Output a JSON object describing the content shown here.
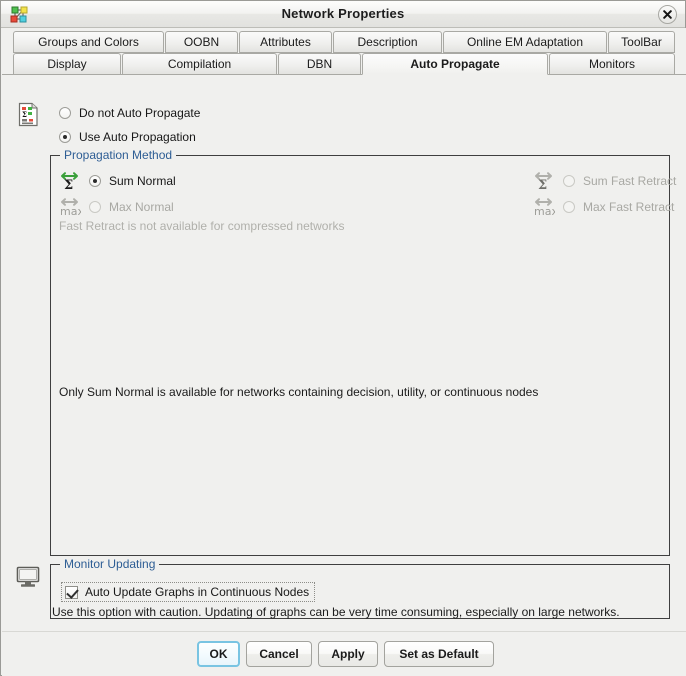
{
  "window": {
    "title": "Network Properties",
    "app_icon": "network-graph-icon",
    "close_label": "✖"
  },
  "tabs": {
    "row1": [
      {
        "label": "Groups and Colors",
        "selected": false
      },
      {
        "label": "OOBN",
        "selected": false
      },
      {
        "label": "Attributes",
        "selected": false
      },
      {
        "label": "Description",
        "selected": false
      },
      {
        "label": "Online EM Adaptation",
        "selected": false
      },
      {
        "label": "ToolBar",
        "selected": false
      }
    ],
    "row2": [
      {
        "label": "Display",
        "selected": false
      },
      {
        "label": "Compilation",
        "selected": false
      },
      {
        "label": "DBN",
        "selected": false
      },
      {
        "label": "Auto Propagate",
        "selected": true
      },
      {
        "label": "Monitors",
        "selected": false
      }
    ]
  },
  "auto_propagate": {
    "mode_options": [
      {
        "label": "Do not Auto Propagate",
        "checked": false,
        "disabled": false
      },
      {
        "label": "Use Auto Propagation",
        "checked": true,
        "disabled": false
      }
    ],
    "propagation_method": {
      "legend": "Propagation Method",
      "left_column": [
        {
          "label": "Sum Normal",
          "checked": true,
          "disabled": false,
          "icon": "sum-sigma-icon"
        },
        {
          "label": "Max Normal",
          "checked": false,
          "disabled": true,
          "icon": "max-icon"
        }
      ],
      "right_column": [
        {
          "label": "Sum Fast Retract",
          "checked": false,
          "disabled": true,
          "icon": "sum-sigma-icon"
        },
        {
          "label": "Max Fast Retract",
          "checked": false,
          "disabled": true,
          "icon": "max-icon"
        }
      ],
      "disabled_hint": "Fast Retract is not available for compressed networks",
      "note": "Only Sum Normal is available for networks containing decision, utility, or continuous nodes"
    },
    "monitor_updating": {
      "legend": "Monitor Updating",
      "checkbox": {
        "label": "Auto Update Graphs in Continuous Nodes",
        "checked": true
      },
      "caution": "Use this option with caution. Updating of graphs can be very time consuming, especially on large networks."
    }
  },
  "buttons": [
    {
      "label": "OK",
      "focused": true
    },
    {
      "label": "Cancel",
      "focused": false
    },
    {
      "label": "Apply",
      "focused": false
    },
    {
      "label": "Set as Default",
      "focused": false
    }
  ],
  "colors": {
    "window_bg": "#f0f0ee",
    "legend_blue": "#2d5d94",
    "disabled_gray": "#b0b0ab",
    "focus_blue": "#79c4e2",
    "sigma_arrow_green": "#3aa03a"
  }
}
